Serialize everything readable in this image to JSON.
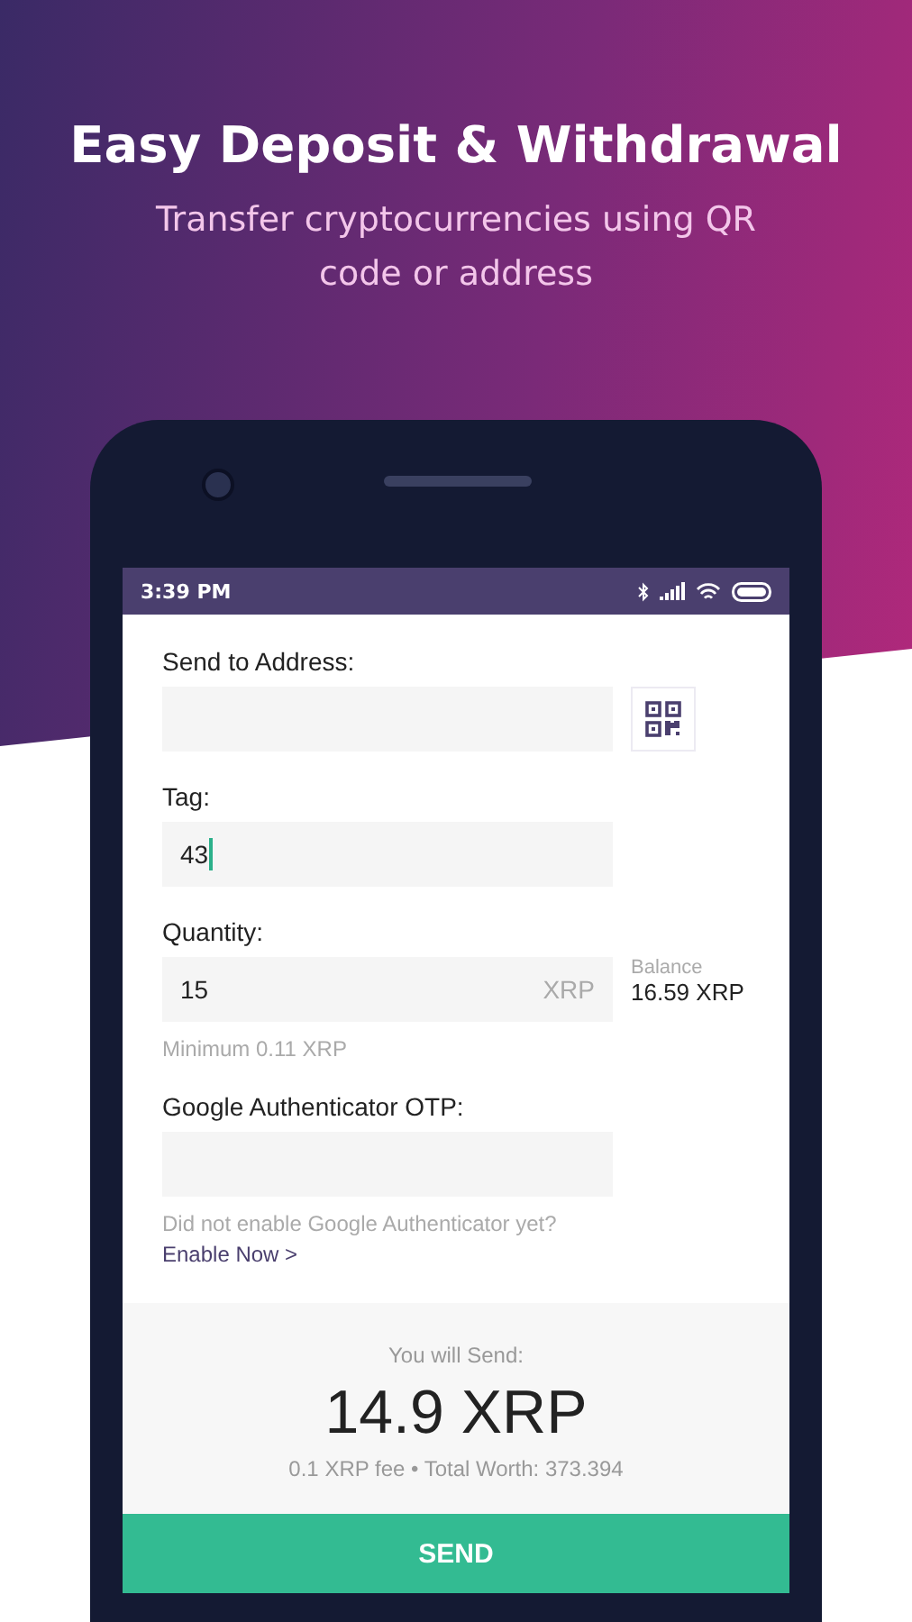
{
  "headline": {
    "title": "Easy Deposit & Withdrawal",
    "subtitle": "Transfer cryptocurrencies using QR code or address"
  },
  "status_bar": {
    "time": "3:39 PM"
  },
  "address": {
    "label": "Send to Address:"
  },
  "tag": {
    "label": "Tag:",
    "value": "43",
    "focused": true
  },
  "quantity": {
    "label": "Quantity:",
    "value": "15",
    "unit": "XRP",
    "hint": "Minimum 0.11 XRP",
    "balance_label": "Balance",
    "balance": "16.59 XRP"
  },
  "otp": {
    "label": "Google Authenticator OTP:",
    "hint": "Did not enable Google Authenticator yet?",
    "link": "Enable Now >"
  },
  "summary": {
    "label": "You will Send:",
    "amount": "14.9 XRP",
    "details": "0.1 XRP fee • Total Worth: 373.394"
  },
  "send_button": "SEND"
}
